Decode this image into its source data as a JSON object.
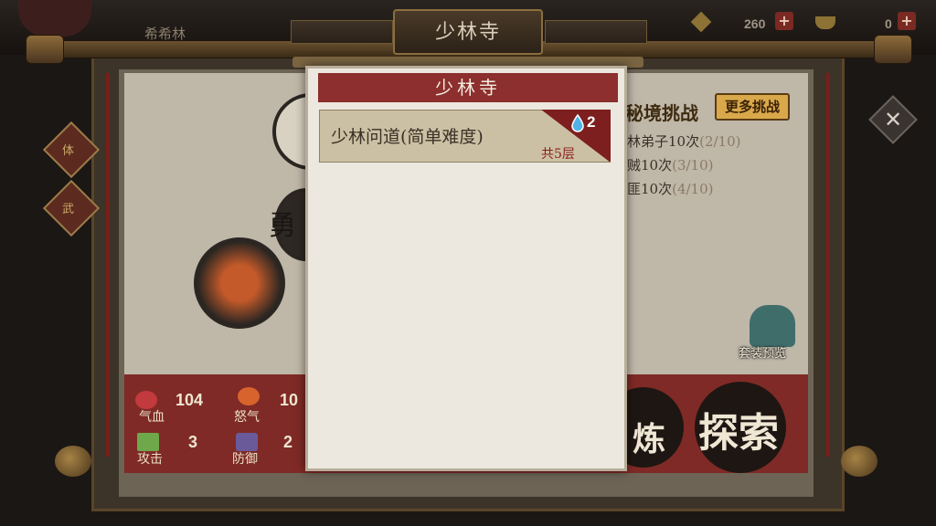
{
  "header": {
    "player_name": "希希林",
    "gold_amount": "260",
    "gold_plus": "+",
    "ingot_amount": "0",
    "ingot_plus": "+",
    "scene_title": "少林寺"
  },
  "left_side": {
    "side_label_1": "体",
    "side_label_2": "武",
    "side_label_3": "勇"
  },
  "challenge": {
    "title": "秘境挑战",
    "more_button": "更多挑战",
    "tasks": [
      {
        "text": "林弟子10次",
        "progress": "(2/10)"
      },
      {
        "text": "贼10次",
        "progress": "(3/10)"
      },
      {
        "text": "匪10次",
        "progress": "(4/10)"
      }
    ],
    "preview_label": "套装预览"
  },
  "stats": {
    "hp_value": "104",
    "hp_label": "气血",
    "rage_value": "10",
    "rage_label": "怒气",
    "attack_value": "3",
    "attack_label": "攻击",
    "defense_value": "2",
    "defense_label": "防御"
  },
  "actions": {
    "refine_label": "炼",
    "explore_label": "探索"
  },
  "modal": {
    "title": "少林寺",
    "entries": [
      {
        "name": "少林问道(简单难度)",
        "floors": "共5层",
        "count": "2"
      }
    ]
  },
  "colors": {
    "modal_header": "#8c2f2e",
    "modal_body": "#ece8df",
    "entry_bg": "#ccc0a4",
    "stat_panel": "#7f2a26",
    "more_button": "#d9a84a"
  }
}
